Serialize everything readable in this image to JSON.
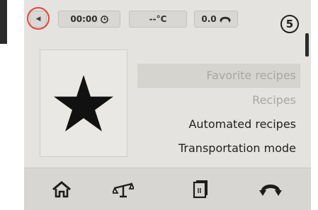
{
  "status_bar": {
    "time": "00:00",
    "temperature": "--°C",
    "speed": "0.0",
    "step_badge": "5"
  },
  "icons": {
    "back": "back-arrow-icon",
    "timer": "clock-icon",
    "speed": "reverse-rotation-icon",
    "favorite": "star-icon",
    "home": "home-icon",
    "scale": "scale-icon",
    "recipe_book": "recipe-book-icon",
    "rotation": "reverse-rotation-icon"
  },
  "menu": {
    "items": [
      {
        "label": "Favorite recipes",
        "state": "selected"
      },
      {
        "label": "Recipes",
        "state": "faded"
      },
      {
        "label": "Automated recipes",
        "state": "normal"
      },
      {
        "label": "Transportation mode",
        "state": "normal"
      }
    ]
  },
  "colors": {
    "screen_bg": "#e4e3df",
    "highlight_ring": "#e0483c",
    "selected_bg": "#d6d4cf"
  }
}
